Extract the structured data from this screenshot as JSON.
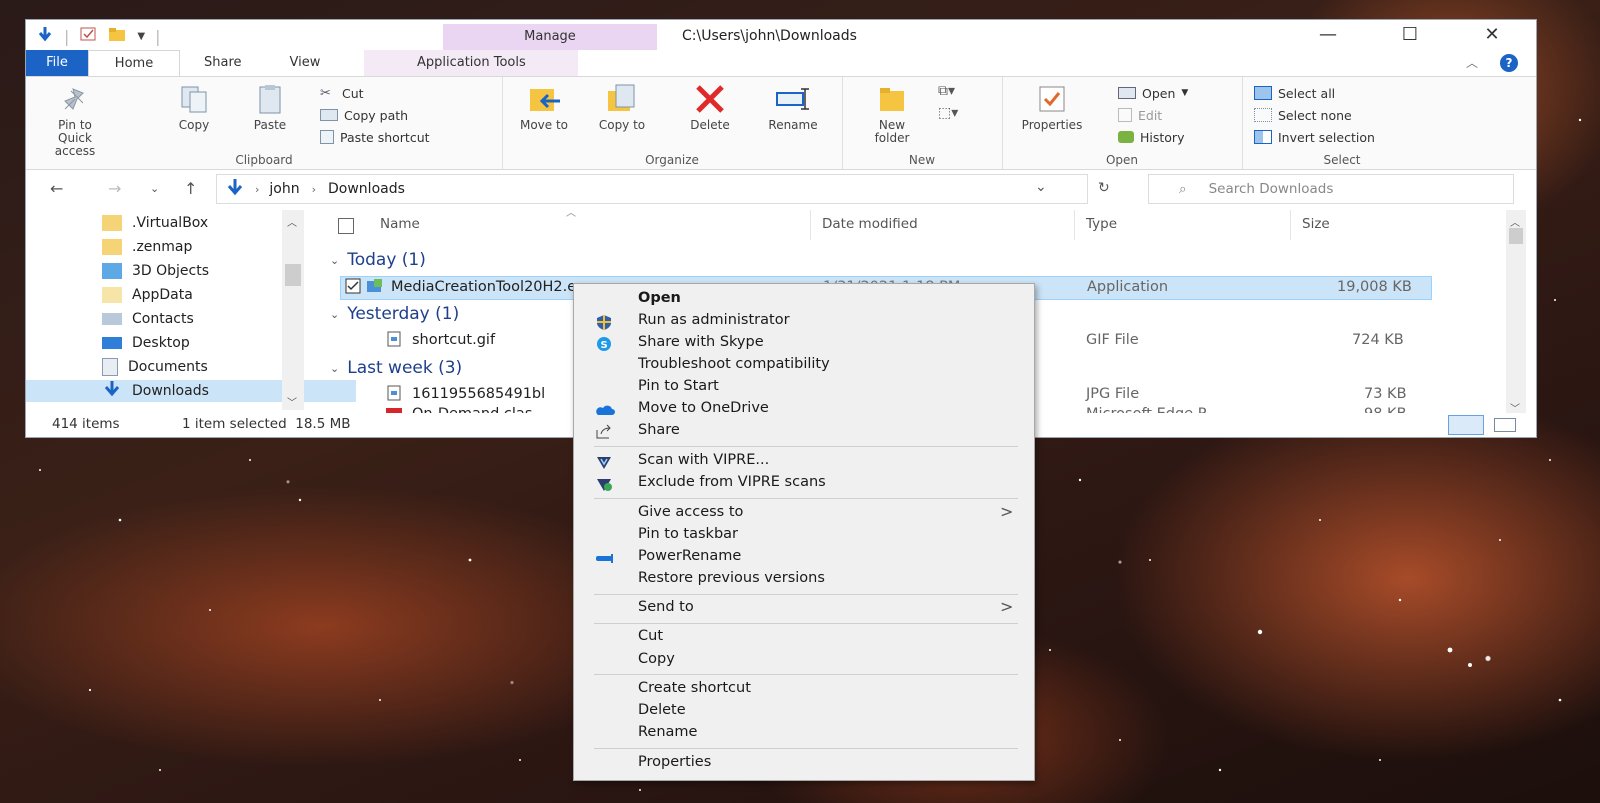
{
  "window": {
    "title_path": "C:\\Users\\john\\Downloads",
    "manage_tab": "Manage",
    "controls": {
      "minimize": "—",
      "maximize": "☐",
      "close": "✕"
    }
  },
  "ribbon_tabs": [
    "File",
    "Home",
    "Share",
    "View",
    "Application Tools"
  ],
  "ribbon": {
    "clipboard": {
      "label": "Clipboard",
      "pin": "Pin to Quick access",
      "copy": "Copy",
      "paste": "Paste",
      "cut": "Cut",
      "copy_path": "Copy path",
      "paste_shortcut": "Paste shortcut"
    },
    "organize": {
      "label": "Organize",
      "move_to": "Move to",
      "copy_to": "Copy to",
      "delete": "Delete",
      "rename": "Rename"
    },
    "new": {
      "label": "New",
      "new_folder": "New folder"
    },
    "open": {
      "label": "Open",
      "properties": "Properties",
      "open": "Open",
      "edit": "Edit",
      "history": "History"
    },
    "select": {
      "label": "Select",
      "select_all": "Select all",
      "select_none": "Select none",
      "invert": "Invert selection"
    }
  },
  "address": {
    "crumbs": [
      "john",
      "Downloads"
    ],
    "search_placeholder": "Search Downloads"
  },
  "nav_pane": [
    {
      "label": ".VirtualBox"
    },
    {
      "label": ".zenmap"
    },
    {
      "label": "3D Objects"
    },
    {
      "label": "AppData"
    },
    {
      "label": "Contacts"
    },
    {
      "label": "Desktop"
    },
    {
      "label": "Documents"
    },
    {
      "label": "Downloads"
    }
  ],
  "columns": {
    "name": "Name",
    "date": "Date modified",
    "type": "Type",
    "size": "Size"
  },
  "groups": {
    "today": "Today (1)",
    "yesterday": "Yesterday (1)",
    "last_week": "Last week (3)"
  },
  "files": [
    {
      "name": "MediaCreationTool20H2.exe",
      "date": "1/31/2021 1:18 PM",
      "type": "Application",
      "size": "19,008 KB"
    },
    {
      "name": "shortcut.gif",
      "date": "",
      "type": "GIF File",
      "size": "724 KB"
    },
    {
      "name": "1611955685491bl",
      "date": "",
      "type": "JPG File",
      "size": "73 KB"
    },
    {
      "name": "On-Demand clas",
      "date": "",
      "type": "Microsoft Edge P...",
      "size": "98 KB"
    }
  ],
  "status": {
    "count": "414 items",
    "selected": "1 item selected  18.5 MB"
  },
  "context_menu": {
    "open": "Open",
    "run_admin": "Run as administrator",
    "skype": "Share with Skype",
    "troubleshoot": "Troubleshoot compatibility",
    "pin_start": "Pin to Start",
    "onedrive": "Move to OneDrive",
    "share": "Share",
    "vipre_scan": "Scan with VIPRE...",
    "vipre_exclude": "Exclude from VIPRE scans",
    "give_access": "Give access to",
    "pin_taskbar": "Pin to taskbar",
    "powerrename": "PowerRename",
    "restore": "Restore previous versions",
    "send_to": "Send to",
    "cut": "Cut",
    "copy": "Copy",
    "create_shortcut": "Create shortcut",
    "delete": "Delete",
    "rename": "Rename",
    "properties": "Properties"
  }
}
